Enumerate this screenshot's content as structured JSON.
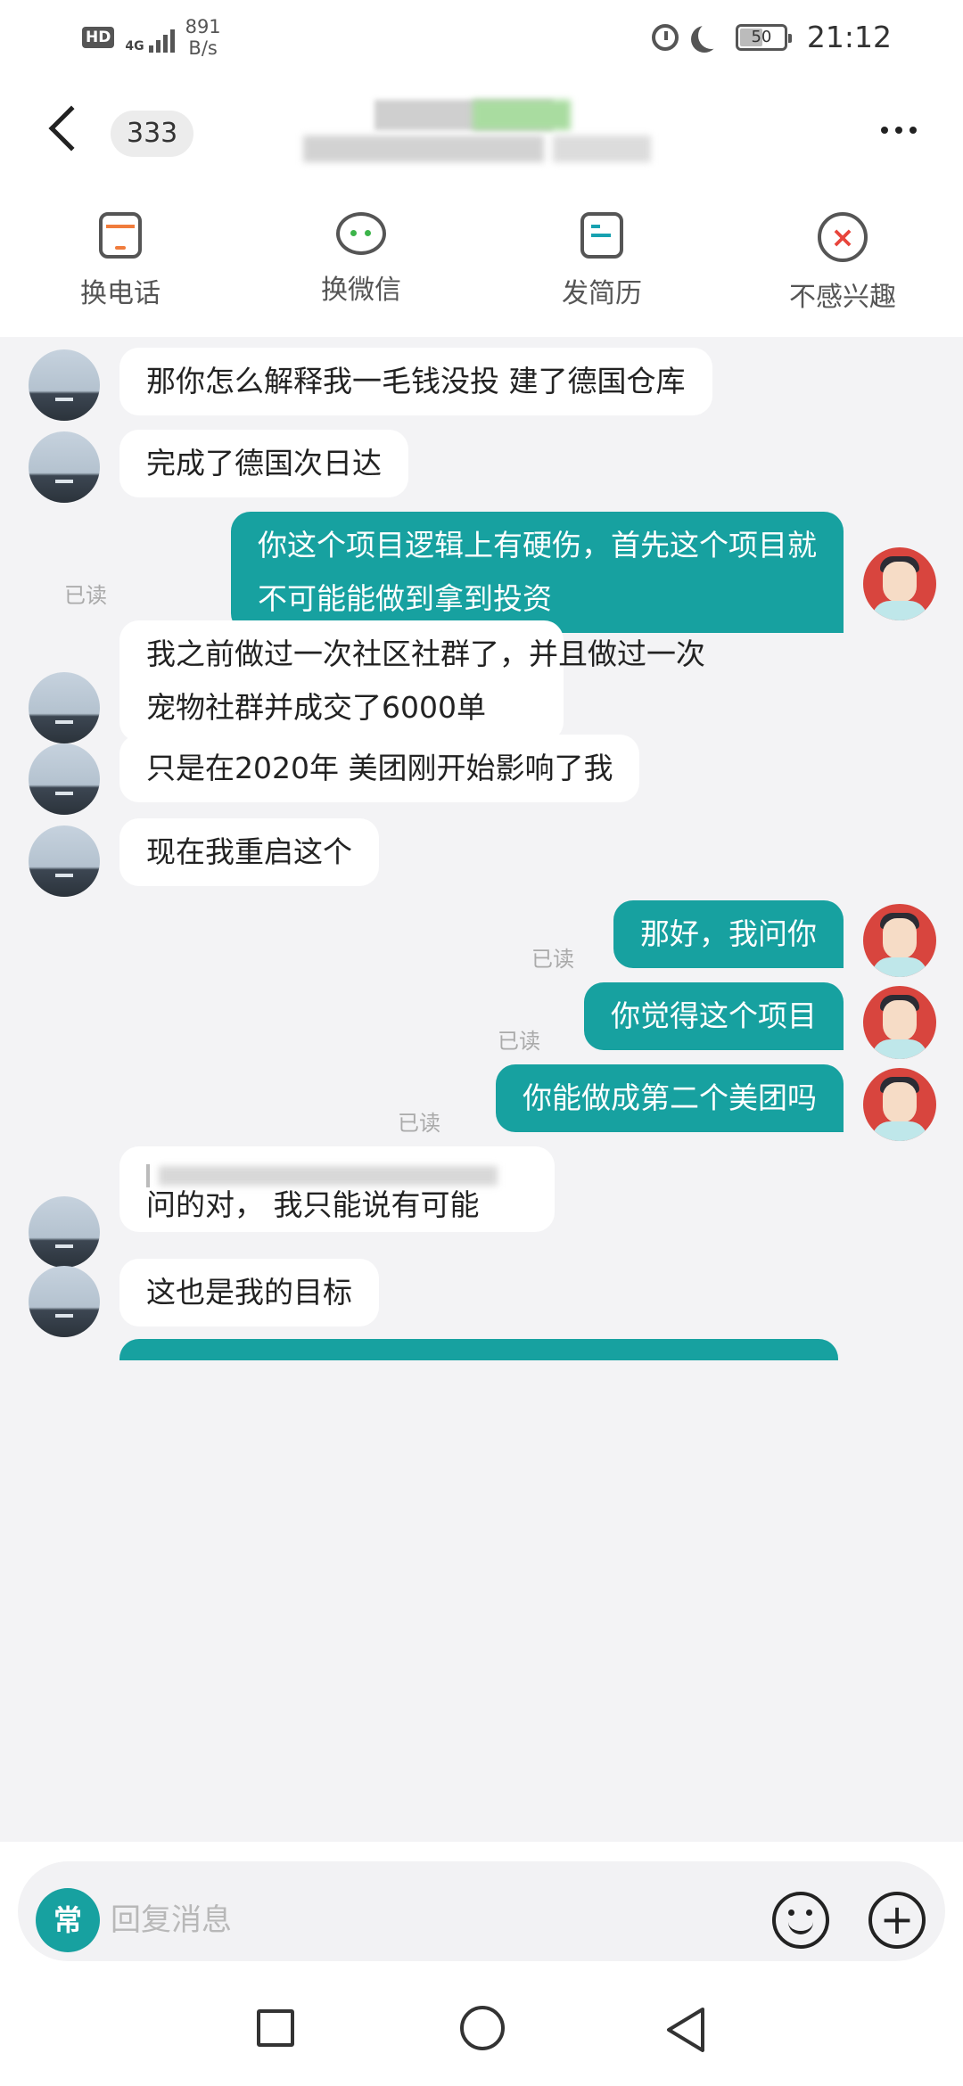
{
  "status_bar": {
    "network_label": "4G",
    "speed_value": "891",
    "speed_unit": "B/s",
    "battery": "50",
    "time": "21:12"
  },
  "header": {
    "unread_count": "333",
    "back_icon": "chevron-left-icon",
    "more_icon": "more-dots-icon"
  },
  "actions": [
    {
      "label": "换电话",
      "icon": "phone-icon"
    },
    {
      "label": "换微信",
      "icon": "wechat-icon"
    },
    {
      "label": "发简历",
      "icon": "resume-icon"
    },
    {
      "label": "不感兴趣",
      "icon": "not-interested-icon"
    }
  ],
  "chat": {
    "read_label": "已读",
    "messages": [
      {
        "from": "other",
        "lines": [
          "那你怎么解释我一毛钱没投 建了德国仓库"
        ]
      },
      {
        "from": "other",
        "lines": [
          "完成了德国次日达"
        ]
      },
      {
        "from": "me",
        "lines": [
          "你这个项目逻辑上有硬伤，首先这个项目就",
          "不可能能做到拿到投资"
        ],
        "read": true
      },
      {
        "from": "other",
        "lines": [
          "我之前做过一次社区社群了，并且做过一次",
          "宠物社群并成交了6000单"
        ]
      },
      {
        "from": "other",
        "lines": [
          "只是在2020年  美团刚开始影响了我"
        ]
      },
      {
        "from": "other",
        "lines": [
          "现在我重启这个"
        ]
      },
      {
        "from": "me",
        "lines": [
          "那好，我问你"
        ],
        "read": true
      },
      {
        "from": "me",
        "lines": [
          "你觉得这个项目"
        ],
        "read": true
      },
      {
        "from": "me",
        "lines": [
          "你能做成第二个美团吗"
        ],
        "read": true
      },
      {
        "from": "other",
        "lines": [
          "问的对， 我只能说有可能"
        ]
      },
      {
        "from": "other",
        "lines": [
          "这也是我的目标"
        ]
      }
    ]
  },
  "input": {
    "phrase_label": "常",
    "placeholder": "回复消息"
  },
  "colors": {
    "accent": "#17a1a0",
    "background": "#f3f3f5",
    "danger": "#e8453c"
  }
}
